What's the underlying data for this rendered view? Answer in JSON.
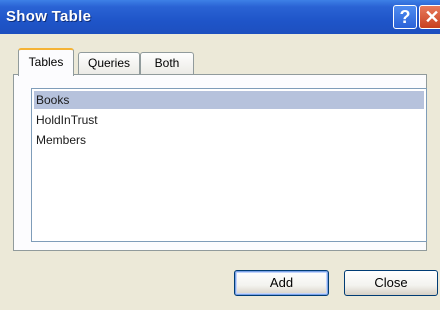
{
  "window": {
    "title": "Show Table",
    "help_glyph": "?",
    "close_glyph": "✕"
  },
  "tabs": [
    {
      "label": "Tables",
      "active": true
    },
    {
      "label": "Queries",
      "active": false
    },
    {
      "label": "Both",
      "active": false
    }
  ],
  "list": {
    "items": [
      {
        "label": "Books",
        "selected": true
      },
      {
        "label": "HoldInTrust",
        "selected": false
      },
      {
        "label": "Members",
        "selected": false
      }
    ]
  },
  "buttons": {
    "add_label": "Add",
    "close_label": "Close"
  },
  "colors": {
    "titlebar": "#1f55c9",
    "selection": "#b6c2dc",
    "dialog_bg": "#ece9d8",
    "close_red": "#c8401f"
  }
}
